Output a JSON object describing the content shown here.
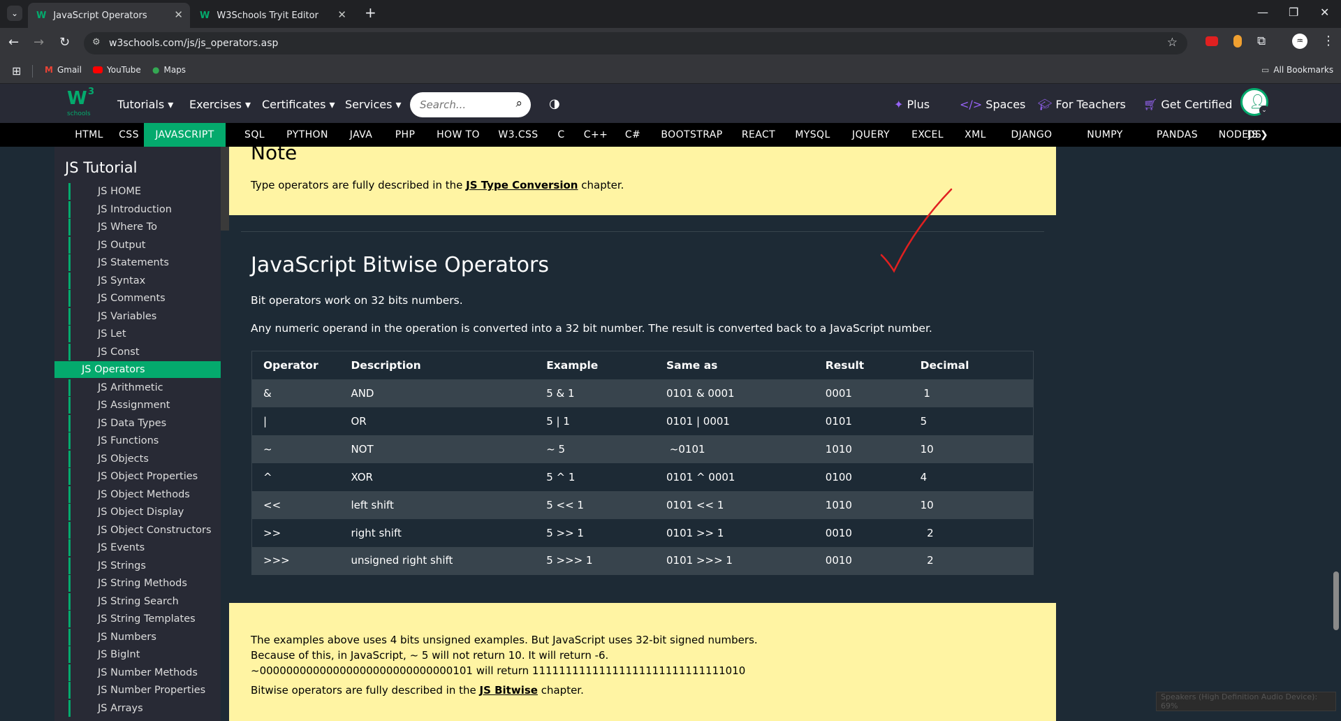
{
  "browser": {
    "tabs": [
      {
        "label": "JavaScript Operators",
        "active": true
      },
      {
        "label": "W3Schools Tryit Editor",
        "active": false
      }
    ],
    "new_tab": "+",
    "url": "w3schools.com/js/js_operators.asp",
    "bookmarks": [
      {
        "label": "Gmail",
        "icon": "gmail-icon"
      },
      {
        "label": "YouTube",
        "icon": "youtube-icon"
      },
      {
        "label": "Maps",
        "icon": "maps-icon"
      }
    ],
    "all_bookmarks": "All Bookmarks"
  },
  "w3": {
    "logo_main": "W",
    "logo_sup": "3",
    "logo_sub": "schools",
    "menu": [
      "Tutorials",
      "Exercises",
      "Certificates",
      "Services"
    ],
    "search_placeholder": "Search...",
    "right_menu": [
      "Plus",
      "Spaces",
      "For Teachers",
      "Get Certified"
    ],
    "subjects": [
      "HTML",
      "CSS",
      "JAVASCRIPT",
      "SQL",
      "PYTHON",
      "JAVA",
      "PHP",
      "HOW TO",
      "W3.CSS",
      "C",
      "C++",
      "C#",
      "BOOTSTRAP",
      "REACT",
      "MYSQL",
      "JQUERY",
      "EXCEL",
      "XML",
      "DJANGO",
      "NUMPY",
      "PANDAS",
      "NODEJS",
      "DS"
    ],
    "active_subject": "JAVASCRIPT"
  },
  "sidebar": {
    "title": "JS Tutorial",
    "items": [
      "JS HOME",
      "JS Introduction",
      "JS Where To",
      "JS Output",
      "JS Statements",
      "JS Syntax",
      "JS Comments",
      "JS Variables",
      "JS Let",
      "JS Const",
      "JS Operators",
      "JS Arithmetic",
      "JS Assignment",
      "JS Data Types",
      "JS Functions",
      "JS Objects",
      "JS Object Properties",
      "JS Object Methods",
      "JS Object Display",
      "JS Object Constructors",
      "JS Events",
      "JS Strings",
      "JS String Methods",
      "JS String Search",
      "JS String Templates",
      "JS Numbers",
      "JS BigInt",
      "JS Number Methods",
      "JS Number Properties",
      "JS Arrays"
    ],
    "active": "JS Operators"
  },
  "content": {
    "note1_title": "Note",
    "note1_pre": "Type operators are fully described in the ",
    "note1_link": "JS Type Conversion",
    "note1_post": " chapter.",
    "heading": "JavaScript Bitwise Operators",
    "p1": "Bit operators work on 32 bits numbers.",
    "p2": "Any numeric operand in the operation is converted into a 32 bit number. The result is converted back to a JavaScript number.",
    "table": {
      "headers": [
        "Operator",
        "Description",
        "Example",
        "Same as",
        "Result",
        "Decimal"
      ],
      "rows": [
        [
          "&",
          "AND",
          "5 & 1",
          "0101 & 0001",
          "0001",
          " 1"
        ],
        [
          "|",
          "OR",
          "5 | 1",
          "0101 | 0001",
          "0101",
          "5"
        ],
        [
          "~",
          "NOT",
          "~ 5",
          " ~0101",
          "1010",
          "10"
        ],
        [
          "^",
          "XOR",
          "5 ^ 1",
          "0101 ^ 0001",
          "0100",
          "4"
        ],
        [
          "<<",
          "left shift",
          "5 << 1",
          "0101 << 1",
          "1010",
          "10"
        ],
        [
          ">>",
          "right shift",
          "5 >> 1",
          "0101 >> 1",
          "0010",
          "  2"
        ],
        [
          ">>>",
          "unsigned right shift",
          "5 >>> 1",
          "0101 >>> 1",
          "0010",
          "  2"
        ]
      ]
    },
    "note2_lines": [
      "The examples above uses 4 bits unsigned examples. But JavaScript uses 32-bit signed numbers.",
      "Because of this, in JavaScript, ~ 5 will not return 10. It will return -6.",
      "~00000000000000000000000000000101 will return 11111111111111111111111111111010"
    ],
    "note2_pre": "Bitwise operators are fully described in the ",
    "note2_link": "JS Bitwise",
    "note2_post": " chapter."
  },
  "system_toast": "Speakers (High Definition Audio Device): 69%",
  "colors": {
    "accent": "#04aa6d",
    "note_bg": "#fff4a3",
    "page_bg": "#1d2a35",
    "checkmark": "#e02020"
  }
}
